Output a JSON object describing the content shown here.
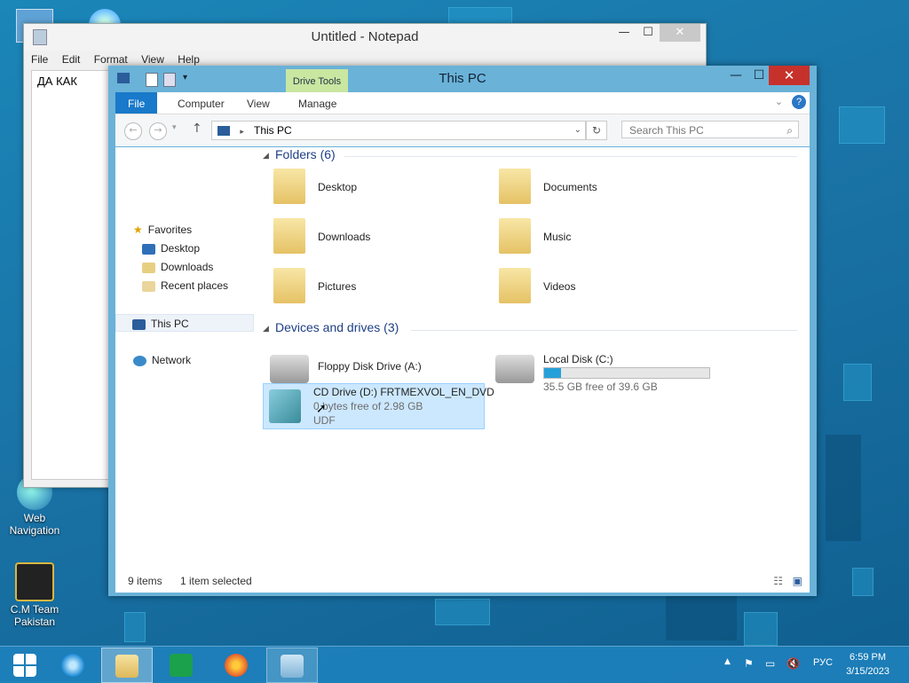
{
  "desktop": {
    "icons": [
      {
        "label": "Web\nNavigation"
      },
      {
        "label": "C.M Team\nPakistan"
      }
    ]
  },
  "notepad": {
    "title": "Untitled - Notepad",
    "menu": [
      "File",
      "Edit",
      "Format",
      "View",
      "Help"
    ],
    "text": "ДА  КАК"
  },
  "explorer": {
    "title": "This PC",
    "contextual_tab": "Drive Tools",
    "tabs": [
      "File",
      "Computer",
      "View",
      "Manage"
    ],
    "address": "This PC",
    "search_placeholder": "Search This PC",
    "nav": {
      "favorites": "Favorites",
      "desktop": "Desktop",
      "downloads": "Downloads",
      "recent": "Recent places",
      "thispc": "This PC",
      "network": "Network"
    },
    "folders_header": "Folders (6)",
    "folders": [
      "Desktop",
      "Documents",
      "Downloads",
      "Music",
      "Pictures",
      "Videos"
    ],
    "devices_header": "Devices and drives (3)",
    "floppy": {
      "label": "Floppy Disk Drive (A:)"
    },
    "localdisk": {
      "label": "Local Disk (C:)",
      "free": "35.5 GB free of 39.6 GB",
      "used_fraction": 0.104
    },
    "cd": {
      "label": "CD Drive (D:) FRTMEXVOL_EN_DVD",
      "free": "0 bytes free of 2.98 GB",
      "fs": "UDF"
    },
    "status_items": "9 items",
    "status_selected": "1 item selected"
  },
  "taskbar": {
    "lang": "РУС",
    "time": "6:59 PM",
    "date": "3/15/2023"
  }
}
